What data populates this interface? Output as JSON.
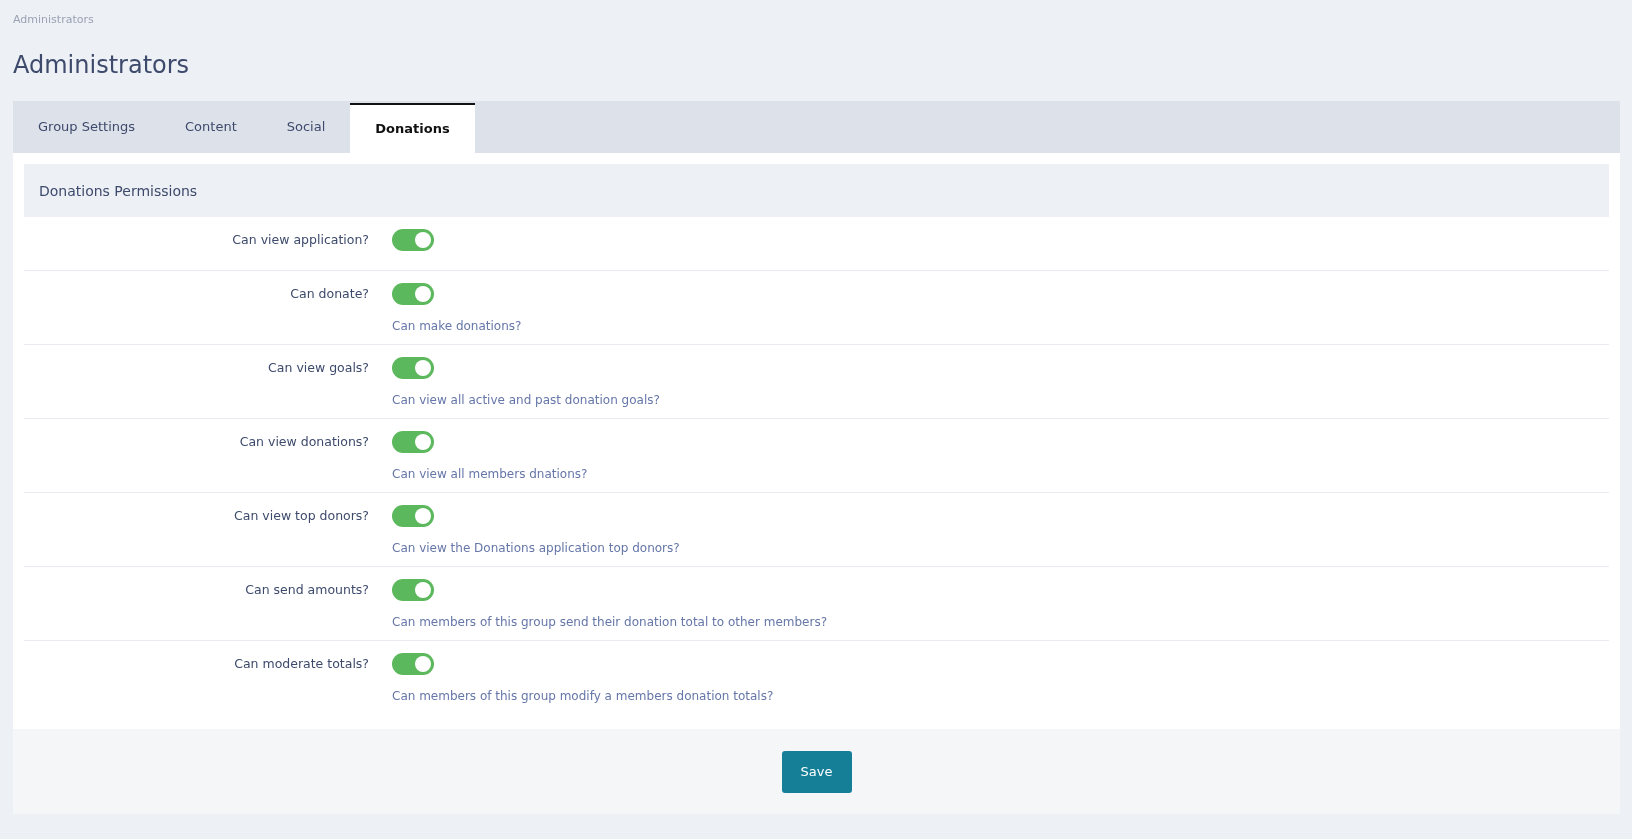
{
  "breadcrumb": "Administrators",
  "title": "Administrators",
  "tabs": [
    {
      "label": "Group Settings",
      "selected": false
    },
    {
      "label": "Content",
      "selected": false
    },
    {
      "label": "Social",
      "selected": false
    },
    {
      "label": "Donations",
      "selected": true
    }
  ],
  "section": {
    "title": "Donations Permissions"
  },
  "permissions": [
    {
      "label": "Can view application?",
      "on": true
    },
    {
      "label": "Can donate?",
      "on": true,
      "help": "Can make donations?"
    },
    {
      "label": "Can view goals?",
      "on": true,
      "help": "Can view all active and past donation goals?"
    },
    {
      "label": "Can view donations?",
      "on": true,
      "help": "Can view all members dnations?"
    },
    {
      "label": "Can view top donors?",
      "on": true,
      "help": "Can view the Donations application top donors?"
    },
    {
      "label": "Can send amounts?",
      "on": true,
      "help": "Can members of this group send their donation total to other members?"
    },
    {
      "label": "Can moderate totals?",
      "on": true,
      "help": "Can members of this group modify a members donation totals?"
    }
  ],
  "save_button": "Save"
}
